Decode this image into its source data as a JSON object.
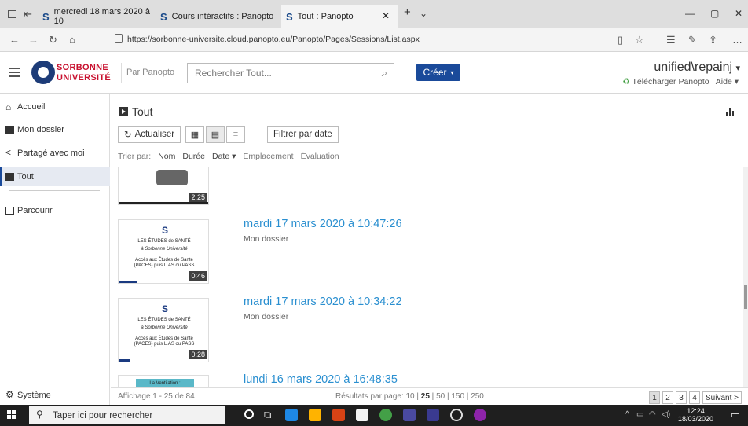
{
  "browser": {
    "tabs": [
      {
        "label": "mercredi 18 mars 2020 à 10",
        "active": false
      },
      {
        "label": "Cours intéractifs : Panopto",
        "active": false
      },
      {
        "label": "Tout : Panopto",
        "active": true
      }
    ],
    "url": "https://sorbonne-universite.cloud.panopto.eu/Panopto/Pages/Sessions/List.aspx"
  },
  "header": {
    "logo_line1": "SORBONNE",
    "logo_line2": "UNIVERSITÉ",
    "by_panopto": "Par Panopto",
    "search_placeholder": "Rechercher Tout...",
    "create_label": "Créer",
    "user_name": "unified\\repainj",
    "download_label": "Télécharger Panopto",
    "help_label": "Aide"
  },
  "sidebar": {
    "items": [
      {
        "label": "Accueil",
        "icon": "home-icon"
      },
      {
        "label": "Mon dossier",
        "icon": "folder-icon"
      },
      {
        "label": "Partagé avec moi",
        "icon": "share-icon"
      },
      {
        "label": "Tout",
        "icon": "play-box-icon",
        "active": true
      },
      {
        "label": "Parcourir",
        "icon": "folder-outline-icon"
      }
    ],
    "system_label": "Système"
  },
  "main": {
    "title": "Tout",
    "refresh_label": "Actualiser",
    "filter_date_label": "Filtrer par date",
    "sort_prefix": "Trier par:",
    "sort_options": [
      "Nom",
      "Durée",
      "Date",
      "Emplacement",
      "Évaluation"
    ],
    "sessions": [
      {
        "title": "",
        "folder": "",
        "duration": "2:25"
      },
      {
        "title": "mardi 17 mars 2020 à 10:47:26",
        "folder": "Mon dossier",
        "duration": "0:46",
        "progress": 0.2
      },
      {
        "title": "mardi 17 mars 2020 à 10:34:22",
        "folder": "Mon dossier",
        "duration": "0:28",
        "progress": 0.12
      },
      {
        "title": "lundi 16 mars 2020 à 16:48:35",
        "folder": "",
        "duration": ""
      }
    ],
    "thumb_text": {
      "line1": "LES ÉTUDES de SANTÉ",
      "line2": "à Sorbonne Université",
      "line3": "Accès aux Études de Santé",
      "line4": "(PACES) puis L.AS ou PASS",
      "thumb4": "La Ventilation :"
    },
    "footer": {
      "showing": "Affichage 1 - 25 de 84",
      "per_page_label": "Résultats par page:",
      "per_page_options": [
        "10",
        "25",
        "50",
        "150",
        "250"
      ],
      "per_page_selected": "25",
      "pages": [
        "1",
        "2",
        "3",
        "4"
      ],
      "next_label": "Suivant >"
    }
  },
  "taskbar": {
    "search_placeholder": "Taper ici pour rechercher",
    "time": "12:24",
    "date": "18/03/2020"
  },
  "colors": {
    "accent": "#1a4a9a",
    "link": "#2a8fd0",
    "brand_red": "#c8102e"
  }
}
